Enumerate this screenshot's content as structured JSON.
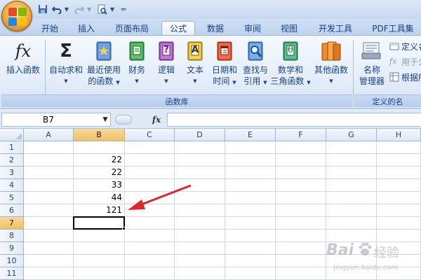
{
  "tabs": [
    "开始",
    "插入",
    "页面布局",
    "公式",
    "数据",
    "审阅",
    "视图",
    "开发工具",
    "PDF工具集"
  ],
  "active_tab": "公式",
  "ribbon": {
    "group_function_library": {
      "label": "函数库",
      "insert_function": "插入函数",
      "autosum": "自动求和",
      "recent_line1": "最近使用",
      "recent_line2": "的函数",
      "financial": "财务",
      "logical": "逻辑",
      "text": "文本",
      "datetime_line1": "日期和",
      "datetime_line2": "时间",
      "lookup_line1": "查找与",
      "lookup_line2": "引用",
      "math_line1": "数学和",
      "math_line2": "三角函数",
      "more": "其他函数"
    },
    "group_defined_names": {
      "label": "定义的名",
      "name_manager_line1": "名称",
      "name_manager_line2": "管理器",
      "define_name": "定义名",
      "use_in_formula": "用于公",
      "create_from_selection": "根据所"
    }
  },
  "icons": {
    "insert_function_glyph": "fx",
    "autosum_glyph": "Σ",
    "logical_glyph": "?",
    "text_glyph": "A",
    "math_glyph": "θ",
    "fx_button_glyph": "fx"
  },
  "formula_bar": {
    "name_box": "B7",
    "formula": ""
  },
  "sheet": {
    "columns": [
      "A",
      "B",
      "C",
      "D",
      "E",
      "F",
      "G",
      "H"
    ],
    "rows": [
      "1",
      "2",
      "3",
      "4",
      "5",
      "6",
      "7",
      "8",
      "9",
      "10",
      "11"
    ],
    "selected_column": "B",
    "selected_row": "7",
    "col_b_values": [
      "",
      "22",
      "22",
      "33",
      "44",
      "121",
      "",
      "",
      "",
      "",
      ""
    ]
  },
  "colors": {
    "arrow": "#e0262b",
    "selection_header": "#f1c15f",
    "ribbon_text": "#15428b"
  },
  "watermark": {
    "brand": "Bai",
    "brand2": "经验",
    "url": "jingyan.baidu.com"
  }
}
